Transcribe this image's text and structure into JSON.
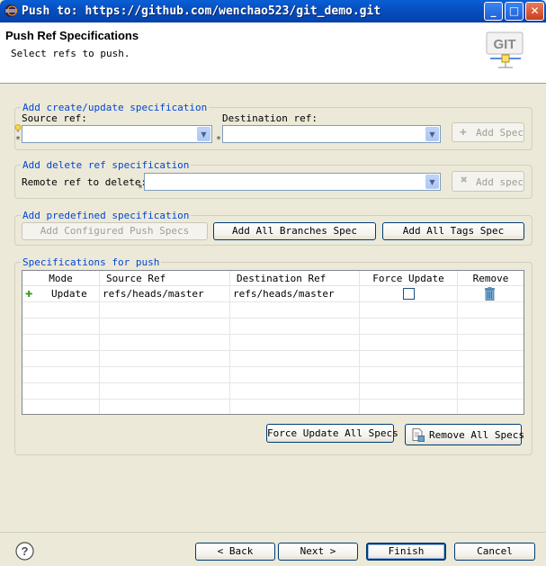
{
  "window": {
    "title": "Push to: https://github.com/wenchao523/git_demo.git",
    "minimize": "_",
    "maximize": "□",
    "close": "✕"
  },
  "header": {
    "title": "Push Ref Specifications",
    "subtitle": "Select refs to push.",
    "logo_text": "GIT"
  },
  "create_update": {
    "legend": "Add create/update specification",
    "source_label": "Source ref:",
    "destination_label": "Destination ref:",
    "source_value": "",
    "destination_value": "",
    "add_spec": "Add Spec"
  },
  "delete_ref": {
    "legend": "Add delete ref specification",
    "remote_label": "Remote ref to delete:",
    "remote_value": "",
    "add_spec": "Add spec"
  },
  "predefined": {
    "legend": "Add predefined specification",
    "configured": "Add Configured Push Specs",
    "all_branches": "Add All Branches Spec",
    "all_tags": "Add All Tags Spec"
  },
  "specs": {
    "legend": "Specifications for push",
    "columns": [
      "Mode",
      "Source Ref",
      "Destination Ref",
      "Force Update",
      "Remove"
    ],
    "rows": [
      {
        "mode": "Update",
        "source": "refs/heads/master",
        "destination": "refs/heads/master",
        "force": false
      }
    ],
    "force_all": "Force Update All Specs",
    "remove_all": "Remove All Specs"
  },
  "footer": {
    "help": "?",
    "back": "< Back",
    "next": "Next >",
    "finish": "Finish",
    "cancel": "Cancel"
  },
  "colors": {
    "titlebar": "#0650c0",
    "legend": "#0046d5",
    "dialog_bg": "#ece9d8"
  }
}
